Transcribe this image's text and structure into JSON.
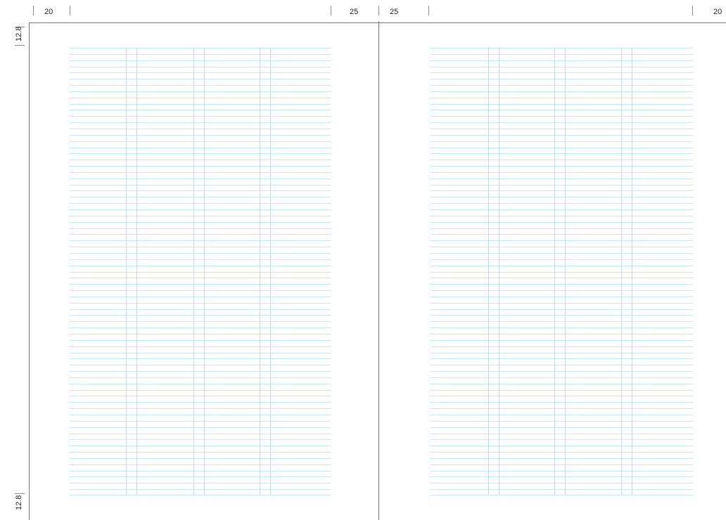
{
  "top_ruler": {
    "left_page_inner_margin": "20",
    "left_page_outer_margin": "25",
    "right_page_inner_margin": "25",
    "right_page_outer_margin": "20"
  },
  "side_ruler": {
    "top_margin": "12.8",
    "bottom_margin": "12.8"
  },
  "ledger": {
    "row_count": 72,
    "line_color": "#c8e6f4",
    "column_rule_color": "#b9ddf0"
  }
}
